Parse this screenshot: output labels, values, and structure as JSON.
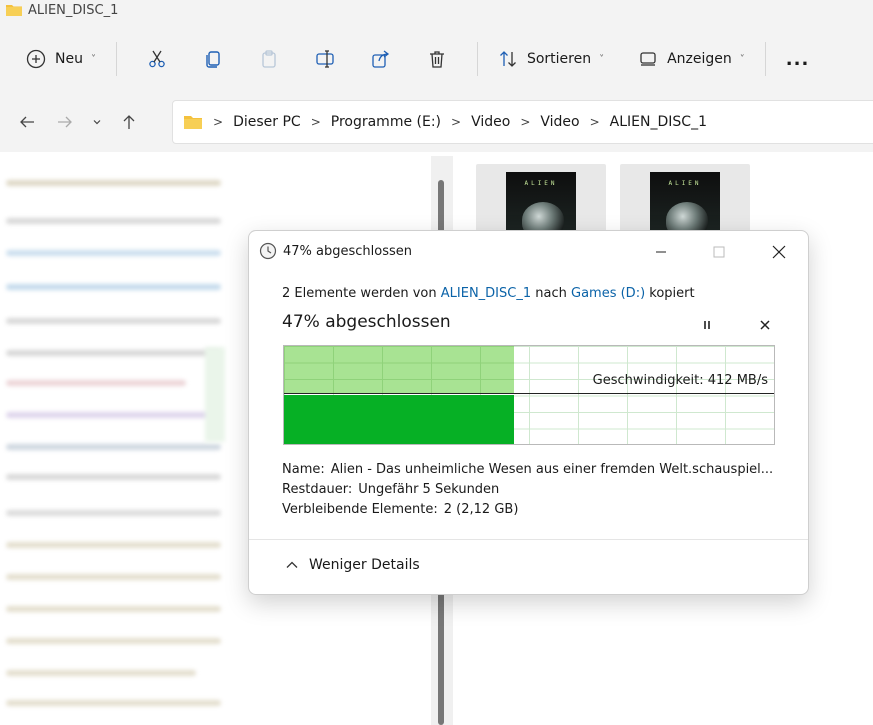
{
  "window": {
    "title": "ALIEN_DISC_1"
  },
  "toolbar": {
    "new_label": "Neu",
    "sort_label": "Sortieren",
    "view_label": "Anzeigen",
    "more_label": "..."
  },
  "addressbar": {
    "crumbs": [
      "Dieser PC",
      "Programme (E:)",
      "Video",
      "Video",
      "ALIEN_DISC_1"
    ]
  },
  "thumbnails": [
    {
      "title": "ALIEN"
    },
    {
      "title": "ALIEN"
    }
  ],
  "dialog": {
    "title": "47% abgeschlossen",
    "msg_prefix": "2 Elemente werden von",
    "source": "ALIEN_DISC_1",
    "msg_mid": "nach",
    "dest": "Games (D:)",
    "msg_suffix": "kopiert",
    "progress_text": "47% abgeschlossen",
    "progress_fraction": 0.47,
    "speed_label": "Geschwindigkeit: 412 MB/s",
    "details": {
      "name_key": "Name:",
      "name_value": "Alien - Das unheimliche Wesen aus einer fremden Welt.schauspiel...",
      "remaining_time_key": "Restdauer:",
      "remaining_time_value": "Ungefähr 5 Sekunden",
      "remaining_items_key": "Verbleibende Elemente:",
      "remaining_items_value": "2 (2,12 GB)"
    },
    "less_details_label": "Weniger Details"
  },
  "colors": {
    "accent_link": "#0b63a8",
    "progress_light": "#a8e393",
    "progress_dark": "#06b025",
    "folder": "#f4c13d"
  }
}
